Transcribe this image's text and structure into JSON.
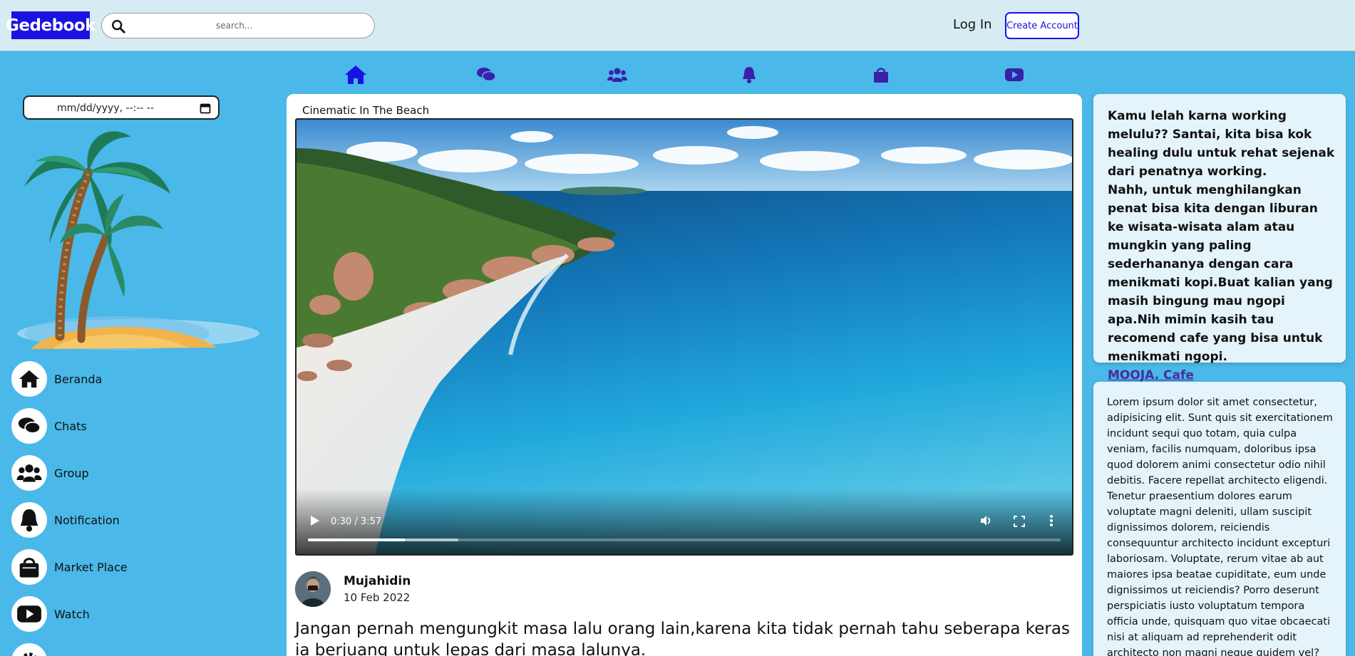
{
  "header": {
    "logo": "Gedebook",
    "search_placeholder": "search...",
    "login_label": "Log In",
    "create_account_label": "Create Account"
  },
  "nav": [
    {
      "icon": "home-icon"
    },
    {
      "icon": "chat-icon"
    },
    {
      "icon": "group-icon"
    },
    {
      "icon": "bell-icon"
    },
    {
      "icon": "shopping-bag-icon"
    },
    {
      "icon": "youtube-icon"
    }
  ],
  "sidebar": {
    "datetime_value": "mm/dd/yyyy, --:-- --",
    "items": [
      {
        "label": "Beranda",
        "icon": "home-icon"
      },
      {
        "label": "Chats",
        "icon": "chat-icon"
      },
      {
        "label": "Group",
        "icon": "group-icon"
      },
      {
        "label": "Notification",
        "icon": "bell-icon"
      },
      {
        "label": "Market Place",
        "icon": "shopping-bag-icon"
      },
      {
        "label": "Watch",
        "icon": "youtube-icon"
      }
    ]
  },
  "post": {
    "video_title": "Cinematic In The Beach",
    "video_time": "0:30 / 3:57",
    "video_progress": 0.13,
    "video_buffered": 0.2,
    "author_name": "Mujahidin",
    "date": "10 Feb 2022",
    "caption": "Jangan pernah mengungkit masa lalu orang lain,karena kita tidak pernah tahu seberapa keras ia berjuang untuk lepas dari masa lalunya."
  },
  "right": {
    "promo_text": "Kamu lelah karna working melulu?? Santai, kita bisa kok healing dulu untuk rehat sejenak dari penatnya working.\nNahh, untuk menghilangkan penat bisa kita dengan liburan ke wisata-wisata alam atau mungkin yang paling sederhananya dengan cara menikmati kopi.Buat kalian yang masih bingung mau ngopi apa.Nih mimin kasih tau recomend cafe yang bisa untuk menikmati ngopi.",
    "promo_link": "MOOJA. Cafe",
    "lorem": "Lorem ipsum dolor sit amet consectetur, adipisicing elit. Sunt quis sit exercitationem incidunt sequi quo totam, quia culpa veniam, facilis numquam, doloribus ipsa quod dolorem animi consectetur odio nihil debitis. Facere repellat architecto eligendi. Tenetur praesentium dolores earum voluptate magni deleniti, ullam suscipit dignissimos dolorem, reiciendis consequuntur architecto incidunt excepturi laboriosam. Voluptate, rerum vitae ab aut maiores ipsa beatae cupiditate, eum unde dignissimos ut reiciendis? Porro deserunt perspiciatis iusto voluptatum tempora officia unde, quisquam quo vitae obcaecati nisi at aliquam ad reprehenderit odit architecto non magni neque quidem vel?"
  },
  "colors": {
    "background": "#4ab8e8",
    "header": "#d6ecf2",
    "brand": "#1a12e0",
    "nav_icon": "#3a1fa8"
  }
}
